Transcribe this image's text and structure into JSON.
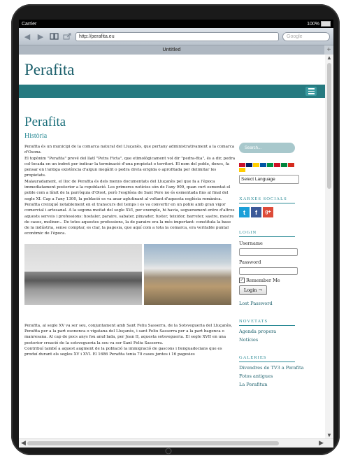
{
  "status_bar": {
    "carrier": "Carrier",
    "battery": "100%"
  },
  "browser": {
    "url": "http://perafita.eu",
    "search_placeholder": "Google",
    "tab_title": "Untitled",
    "new_tab": "+",
    "icons": [
      "back-arrow-icon",
      "forward-arrow-icon",
      "bookmarks-book-icon",
      "share-icon"
    ]
  },
  "site": {
    "title": "Perafita",
    "menu_icon": "hamburger-icon"
  },
  "article": {
    "title": "Perafita",
    "subtitle": "Història",
    "paragraph1": "Perafita és un municipi de la comarca natural del Lluçanès, que pertany administrativament a la comarca d'Osona.",
    "paragraph2": "El topònim \"Perafita\" prové del llatí \"Petra Ficta\", que etimològicament vol dir \"pedra-fita\", és a dir, pedra col·locada en un indret per indicar la terminació d'una propietat o territori. El nom del poble, doncs, fa pensar en l'antiga existència d'algun megàlit o pedra dreta erigida o aprofitada per delimitar les propietats.",
    "paragraph3": "Malauradament, el lloc de Perafita és dels menys documentats del Lluçanès pel que fa a l'època immediatament posterior a la repoblació. Les primeres notícies són de l'any 909, quan curt esmentat el poble com a límit de la parròquia d'Olost, però l'església de Sant Pere no és esmentada fins al final del segle XI. Cap a l'any 1300, la població es va anar aglutinant al voltant d'aquesta església romànica. Perafita creixqué notablement en el transcurs del temps i es va convertir en un poble amb gran vigor comercial i artesanal. A la segona meitat del segle XVI, per exemple, hi havia, seguerament entre d'altres aquests serveis i professions: hostaler, paraire, sabater, pinyader, fuster, teixidor, barreter, sastre, mestre de cases, moliner... De totes aquestes professions, la de paraire era la més important: constituïa la base de la indústria, sense comptar, es clar, la pagesia, que aquí com a tota la comarca, era veritable puntal econòmic de l'època.",
    "paragraph4": "Perafita, al segle XV va ser seu, conjuntament amb Sant Feliu Sasserra, de la Sotsvegueria del Lluçanès, Perafita per a la part osonenca o vigatana del Lluçanès, i sant Feliu Sasserra per a la part bagenca o manresana. Al cap de pocs anys fou anul·lada, per Joan II, aquesta sotsvegueria. El segle XVII en una posterior creació de la sotsvegueria la seu va ser Sant Feliu Sasserra.",
    "paragraph5": "Contribuí també a aquest augment de la població la immigració de gascons i llenguadocians que es produí durant els segles XV i XVI. El 1686 Perafita tenia 70 cases juntes i 16 pagesies"
  },
  "sidebar": {
    "search_placeholder": "Search...",
    "language_select": "Select Language",
    "social_heading": "XARXES SOCIALS",
    "social_icons": [
      "twitter-icon",
      "facebook-icon",
      "google-plus-icon"
    ],
    "social_labels": [
      "t",
      "f",
      "g+"
    ],
    "login_heading": "LOGIN",
    "username_label": "Username",
    "password_label": "Password",
    "remember_label": "Remember Me",
    "login_button": "Login →",
    "lost_password": "Lost Password",
    "news_heading": "NOVETATS",
    "news_links": [
      "Agenda propera",
      "Notícies"
    ],
    "galleries_heading": "GALERIES",
    "gallery_links": [
      "Divendres de TV3 a Perafita",
      "Fotos antigues",
      "La Perafitun"
    ],
    "flag_colors": [
      "#c8102e",
      "#012169",
      "#ffce00",
      "#0055a4",
      "#009246",
      "#ce1126",
      "#00843d",
      "#d52b1e",
      "#ffcc00"
    ]
  }
}
